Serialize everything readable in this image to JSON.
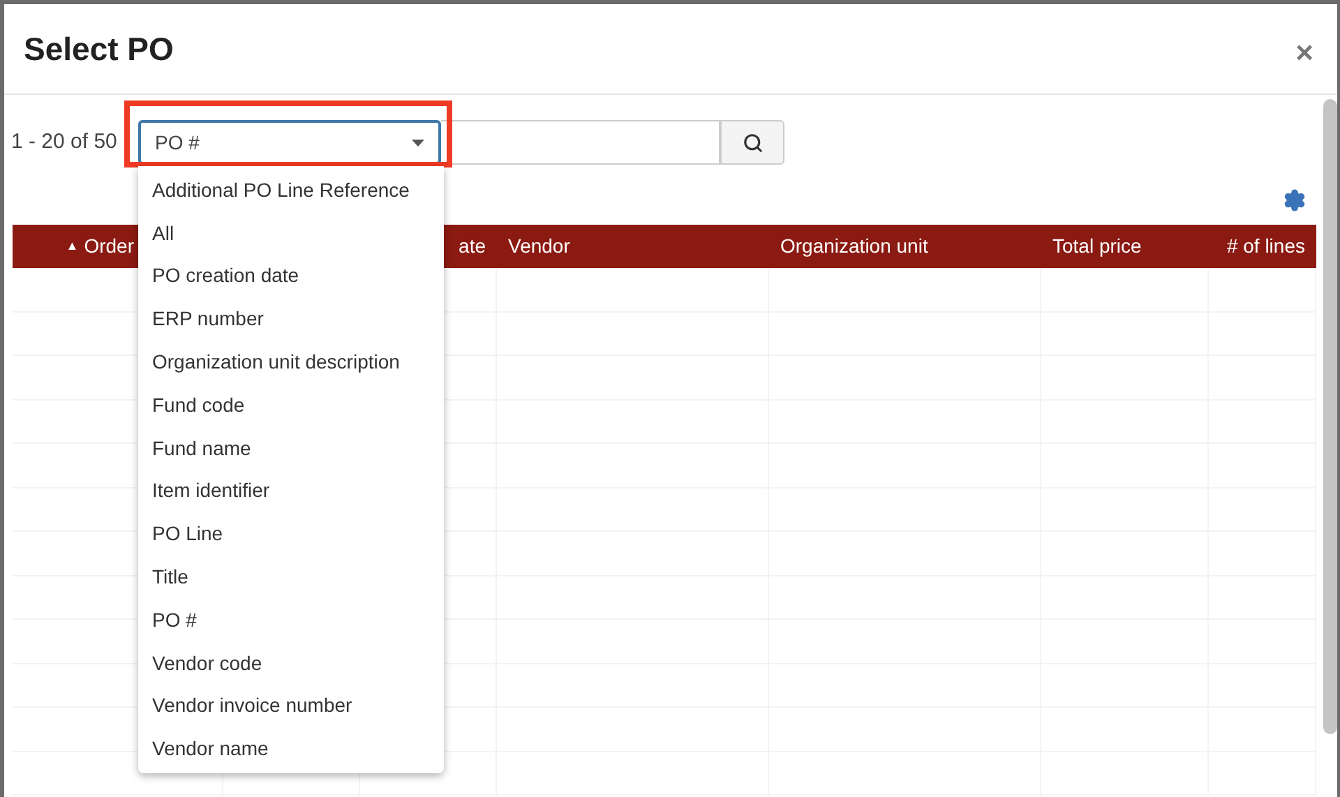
{
  "dialog": {
    "title": "Select PO",
    "close": "×"
  },
  "toolbar": {
    "count": "1 - 20 of 50",
    "search_by": "PO #"
  },
  "table": {
    "columns": [
      {
        "label": "Order",
        "sort_indicator": "▲"
      },
      {
        "label": "ate"
      },
      {
        "label": "Vendor"
      },
      {
        "label": "Organization unit"
      },
      {
        "label": "Total price"
      },
      {
        "label": "# of lines"
      }
    ]
  },
  "dropdown": {
    "options": [
      "Additional PO Line Reference",
      "All",
      "PO creation date",
      "ERP number",
      "Organization unit description",
      "Fund code",
      "Fund name",
      "Item identifier",
      "PO Line",
      "Title",
      "PO #",
      "Vendor code",
      "Vendor invoice number",
      "Vendor name"
    ]
  }
}
